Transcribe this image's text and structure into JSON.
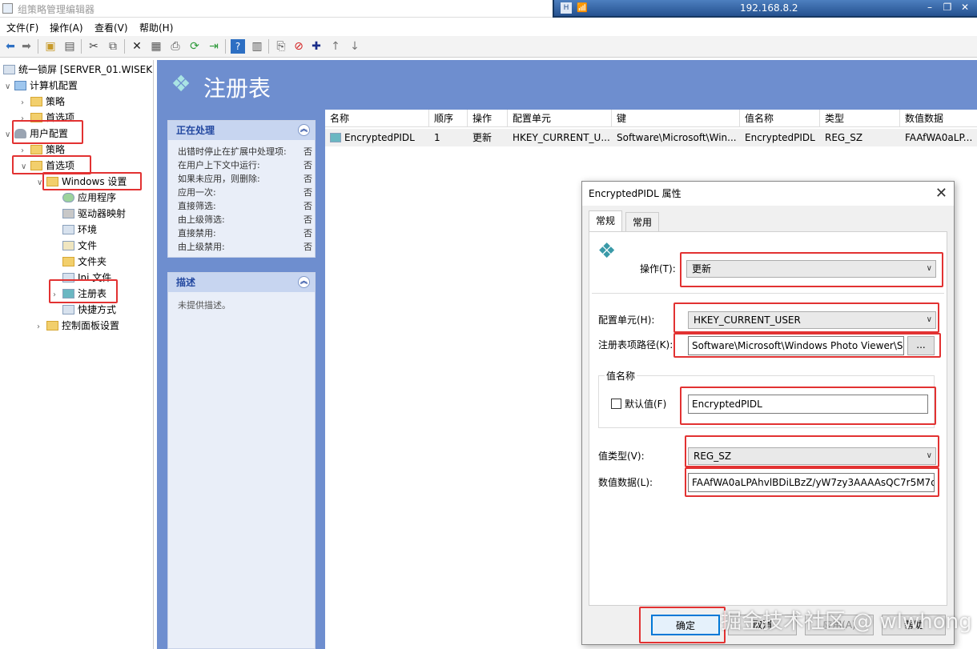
{
  "window": {
    "title": "组策略管理编辑器"
  },
  "rdp": {
    "address": "192.168.8.2",
    "signal": "📶"
  },
  "menu": [
    {
      "label": "文件(F)"
    },
    {
      "label": "操作(A)"
    },
    {
      "label": "查看(V)"
    },
    {
      "label": "帮助(H)"
    }
  ],
  "tree": {
    "root": "统一锁屏 [SERVER_01.WISEKI",
    "computer": "计算机配置",
    "c_policy": "策略",
    "c_prefs": "首选项",
    "user": "用户配置",
    "u_policy": "策略",
    "u_prefs": "首选项",
    "windows_settings": "Windows 设置",
    "apps": "应用程序",
    "drive_maps": "驱动器映射",
    "environment": "环境",
    "files": "文件",
    "folders": "文件夹",
    "ini": "Ini 文件",
    "registry": "注册表",
    "shortcuts": "快捷方式",
    "control_panel": "控制面板设置"
  },
  "banner": {
    "title": "注册表"
  },
  "processing": {
    "header": "正在处理",
    "rows": [
      {
        "k": "出错时停止在扩展中处理项:",
        "v": "否"
      },
      {
        "k": "在用户上下文中运行:",
        "v": "否"
      },
      {
        "k": "如果未应用，则删除:",
        "v": "否"
      },
      {
        "k": "应用一次:",
        "v": "否"
      },
      {
        "k": "直接筛选:",
        "v": "否"
      },
      {
        "k": "由上级筛选:",
        "v": "否"
      },
      {
        "k": "直接禁用:",
        "v": "否"
      },
      {
        "k": "由上级禁用:",
        "v": "否"
      }
    ]
  },
  "description": {
    "header": "描述",
    "text": "未提供描述。"
  },
  "list": {
    "headers": {
      "name": "名称",
      "order": "顺序",
      "action": "操作",
      "hive": "配置单元",
      "key": "键",
      "value_name": "值名称",
      "type": "类型",
      "data": "数值数据"
    },
    "row": {
      "name": "EncryptedPIDL",
      "order": "1",
      "action": "更新",
      "hive": "HKEY_CURRENT_U...",
      "key": "Software\\Microsoft\\Win...",
      "value_name": "EncryptedPIDL",
      "type": "REG_SZ",
      "data": "FAAfWA0aLP..."
    }
  },
  "dialog": {
    "title": "EncryptedPIDL 属性",
    "tab_general": "常规",
    "tab_common": "常用",
    "action_label": "操作(T):",
    "action_value": "更新",
    "hive_label": "配置单元(H):",
    "hive_value": "HKEY_CURRENT_USER",
    "key_label": "注册表项路径(K):",
    "key_value": "Software\\Microsoft\\Windows Photo Viewer\\S",
    "browse": "...",
    "value_name_group": "值名称",
    "default_label": "默认值(F)",
    "value_name": "EncryptedPIDL",
    "type_label": "值类型(V):",
    "type_value": "REG_SZ",
    "data_label": "数值数据(L):",
    "data_value": "FAAfWA0aLPAhvlBDiLBzZ/yW7zy3AAAAsQC7r5M7o",
    "ok": "确定",
    "cancel": "取消",
    "apply": "应用(A)",
    "help": "帮助"
  },
  "watermark": "掘金技术社区 @ wlwhong",
  "colors": {
    "accent": "#6e8ecf",
    "highlight": "#e23232"
  }
}
